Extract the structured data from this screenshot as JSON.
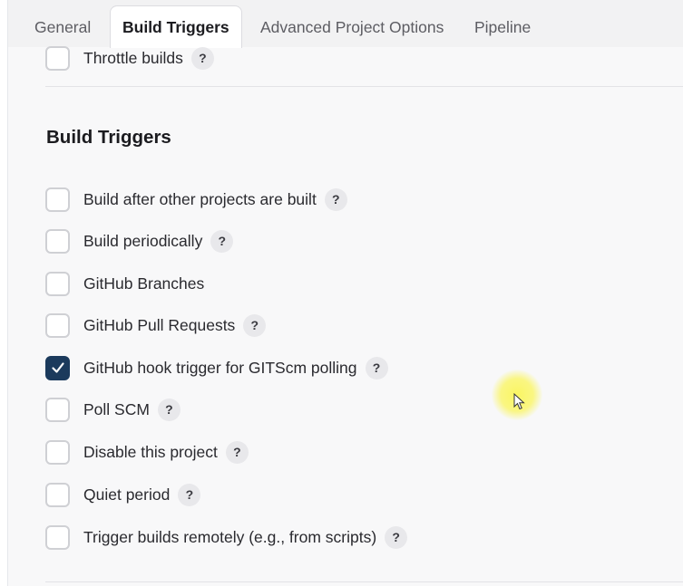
{
  "tabs": [
    {
      "label": "General"
    },
    {
      "label": "Build Triggers",
      "active": true
    },
    {
      "label": "Advanced Project Options"
    },
    {
      "label": "Pipeline"
    }
  ],
  "throttle": {
    "label": "Throttle builds",
    "checked": false,
    "help": "?"
  },
  "section": {
    "title": "Build Triggers"
  },
  "triggers": [
    {
      "label": "Build after other projects are built",
      "checked": false,
      "help": "?"
    },
    {
      "label": "Build periodically",
      "checked": false,
      "help": "?"
    },
    {
      "label": "GitHub Branches",
      "checked": false
    },
    {
      "label": "GitHub Pull Requests",
      "checked": false,
      "help": "?"
    },
    {
      "label": "GitHub hook trigger for GITScm polling",
      "checked": true,
      "help": "?"
    },
    {
      "label": "Poll SCM",
      "checked": false,
      "help": "?"
    },
    {
      "label": "Disable this project",
      "checked": false,
      "help": "?"
    },
    {
      "label": "Quiet period",
      "checked": false,
      "help": "?"
    },
    {
      "label": "Trigger builds remotely (e.g., from scripts)",
      "checked": false,
      "help": "?"
    }
  ],
  "icons": {
    "checkmark": "check-icon",
    "help": "question-mark-icon",
    "cursor": "mouse-pointer-icon"
  },
  "colors": {
    "accent": "#1b3a5c",
    "cursor_highlight": "#faf55a"
  }
}
